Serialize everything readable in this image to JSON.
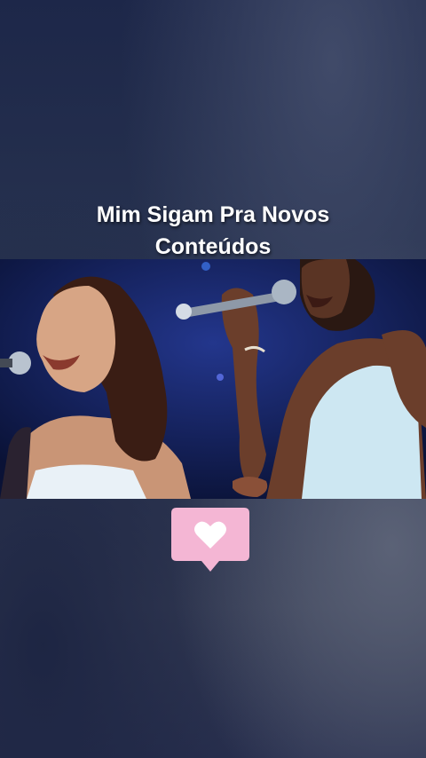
{
  "caption": {
    "line1": "Mim Sigam Pra Novos",
    "line2": "Conteúdos"
  },
  "video": {
    "icon": "concert-video-frame"
  },
  "like_badge": {
    "icon": "heart-icon",
    "color": "#f4b6d4"
  }
}
